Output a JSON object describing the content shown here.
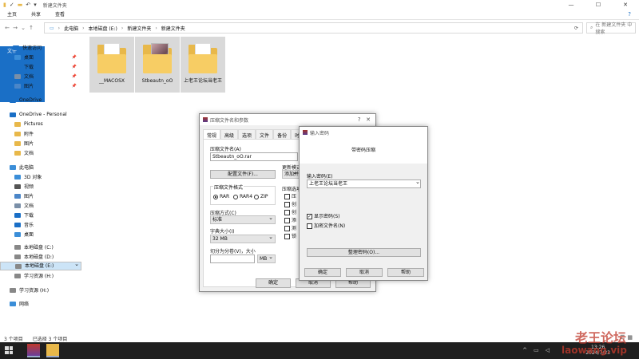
{
  "explorer": {
    "title": "新建文件夹",
    "ribbon": [
      "文件",
      "主页",
      "共享",
      "查看"
    ],
    "path": [
      "此电脑",
      "本地磁盘 (E:)",
      "新建文件夹",
      "新建文件夹"
    ],
    "search_placeholder": "在 新建文件夹 中搜索",
    "sidebar": [
      {
        "label": "快速访问",
        "icon": "star-icon",
        "color": "#1a6fc6"
      },
      {
        "label": "桌面",
        "icon": "desktop-icon",
        "color": "#3b8ed8",
        "pinned": true
      },
      {
        "label": "下载",
        "icon": "download-icon",
        "color": "#1a6fc6",
        "pinned": true
      },
      {
        "label": "文档",
        "icon": "document-icon",
        "color": "#7a8fa8",
        "pinned": true
      },
      {
        "label": "图片",
        "icon": "picture-icon",
        "color": "#4b86c8",
        "pinned": true
      },
      {
        "label": "OneDrive",
        "icon": "cloud-icon",
        "color": "#1a6fc6"
      },
      {
        "label": "OneDrive - Personal",
        "icon": "cloud-icon",
        "color": "#1a6fc6"
      },
      {
        "label": "Pictures",
        "icon": "folder-icon",
        "color": "#e8b84a"
      },
      {
        "label": "附件",
        "icon": "folder-icon",
        "color": "#e8b84a"
      },
      {
        "label": "图片",
        "icon": "folder-icon",
        "color": "#e8b84a"
      },
      {
        "label": "文档",
        "icon": "folder-icon",
        "color": "#e8b84a"
      },
      {
        "label": "此电脑",
        "icon": "computer-icon",
        "color": "#3b8ed8"
      },
      {
        "label": "3D 对象",
        "icon": "cube-icon",
        "color": "#3b8ed8"
      },
      {
        "label": "视频",
        "icon": "video-icon",
        "color": "#555555"
      },
      {
        "label": "图片",
        "icon": "picture-icon",
        "color": "#4b86c8"
      },
      {
        "label": "文档",
        "icon": "document-icon",
        "color": "#7a8fa8"
      },
      {
        "label": "下载",
        "icon": "download-icon",
        "color": "#1a6fc6"
      },
      {
        "label": "音乐",
        "icon": "music-icon",
        "color": "#1a6fc6"
      },
      {
        "label": "桌面",
        "icon": "desktop-icon",
        "color": "#3b8ed8"
      },
      {
        "label": "本地磁盘 (C:)",
        "icon": "drive-icon",
        "color": "#888888"
      },
      {
        "label": "本地磁盘 (D:)",
        "icon": "drive-icon",
        "color": "#888888"
      },
      {
        "label": "本地磁盘 (E:)",
        "icon": "drive-icon",
        "color": "#888888",
        "selected": true
      },
      {
        "label": "学习资源 (H:)",
        "icon": "drive-icon",
        "color": "#888888"
      },
      {
        "label": "学习资源 (H:)",
        "icon": "drive-icon",
        "color": "#888888"
      },
      {
        "label": "网络",
        "icon": "network-icon",
        "color": "#3b8ed8"
      }
    ],
    "files": [
      {
        "name": "__MACOSX",
        "kind": "paper"
      },
      {
        "name": "Stbeautn_oO",
        "kind": "photo"
      },
      {
        "name": "上老王论坛当老王",
        "kind": "paper"
      }
    ],
    "status": {
      "count": "3 个项目",
      "selected": "已选择 3 个项目"
    }
  },
  "archive_dialog": {
    "title": "压缩文件名和参数",
    "tabs": [
      "常规",
      "高级",
      "选项",
      "文件",
      "备份",
      "时"
    ],
    "archive_name_label": "压缩文件名(A)",
    "archive_name": "Stbeautn_oO.rar",
    "browse": "配置文件(F)...",
    "update_label": "更新模式",
    "update_value": "添加并替换",
    "format_label": "压缩文件格式",
    "formats": [
      "RAR",
      "RAR4",
      "ZIP"
    ],
    "method_label": "压缩方式(C)",
    "method": "标准",
    "dict_label": "字典大小(I)",
    "dict": "32 MB",
    "split_label": "切分为分卷(V)，大小",
    "split_unit": "MB",
    "options_label": "压缩选项",
    "options": [
      "压",
      "创",
      "创",
      "添",
      "测",
      "锁"
    ],
    "ok": "确定",
    "cancel": "取消",
    "help": "帮助"
  },
  "password_dialog": {
    "title": "输入密码",
    "heading": "带密码压缩",
    "prompt": "输入密码(E)",
    "password": "上老王论坛当老王",
    "show_password": "显示密码(S)",
    "encrypt_names": "加密文件名(N)",
    "organize": "整理密码(O)...",
    "ok": "确定",
    "cancel": "取消",
    "help": "帮助"
  },
  "taskbar": {
    "time": "13:26",
    "date": "2024/7/23"
  },
  "watermark": {
    "line1": "老王论坛",
    "line2": "laowang.vip"
  }
}
